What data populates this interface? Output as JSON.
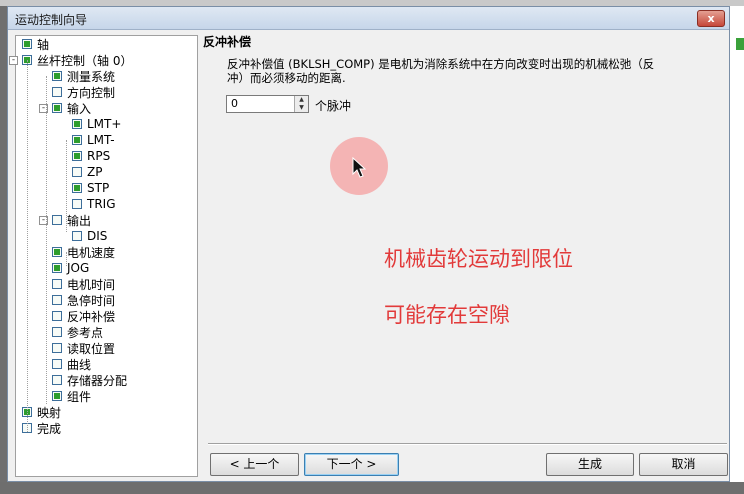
{
  "window": {
    "title": "运动控制向导",
    "close_label": "x"
  },
  "tree": [
    {
      "label": "轴",
      "state": "on",
      "depth": 0,
      "expander": ""
    },
    {
      "label": "丝杆控制（轴 0）",
      "state": "on",
      "depth": 0,
      "expander": "-"
    },
    {
      "label": "测量系统",
      "state": "on",
      "depth": 1,
      "expander": ""
    },
    {
      "label": "方向控制",
      "state": "off",
      "depth": 1,
      "expander": ""
    },
    {
      "label": "输入",
      "state": "on",
      "depth": 1,
      "expander": "-"
    },
    {
      "label": "LMT+",
      "state": "on",
      "depth": 2,
      "expander": ""
    },
    {
      "label": "LMT-",
      "state": "on",
      "depth": 2,
      "expander": ""
    },
    {
      "label": "RPS",
      "state": "on",
      "depth": 2,
      "expander": ""
    },
    {
      "label": "ZP",
      "state": "off",
      "depth": 2,
      "expander": ""
    },
    {
      "label": "STP",
      "state": "on",
      "depth": 2,
      "expander": ""
    },
    {
      "label": "TRIG",
      "state": "off",
      "depth": 2,
      "expander": ""
    },
    {
      "label": "输出",
      "state": "off",
      "depth": 1,
      "expander": "-"
    },
    {
      "label": "DIS",
      "state": "off",
      "depth": 2,
      "expander": ""
    },
    {
      "label": "电机速度",
      "state": "on",
      "depth": 1,
      "expander": ""
    },
    {
      "label": "JOG",
      "state": "on",
      "depth": 1,
      "expander": ""
    },
    {
      "label": "电机时间",
      "state": "off",
      "depth": 1,
      "expander": ""
    },
    {
      "label": "急停时间",
      "state": "off",
      "depth": 1,
      "expander": ""
    },
    {
      "label": "反冲补偿",
      "state": "off",
      "depth": 1,
      "expander": ""
    },
    {
      "label": "参考点",
      "state": "off",
      "depth": 1,
      "expander": ""
    },
    {
      "label": "读取位置",
      "state": "off",
      "depth": 1,
      "expander": ""
    },
    {
      "label": "曲线",
      "state": "off",
      "depth": 1,
      "expander": ""
    },
    {
      "label": "存储器分配",
      "state": "off",
      "depth": 1,
      "expander": ""
    },
    {
      "label": "组件",
      "state": "on",
      "depth": 1,
      "expander": ""
    },
    {
      "label": "映射",
      "state": "on",
      "depth": 0,
      "expander": ""
    },
    {
      "label": "完成",
      "state": "off",
      "depth": 0,
      "expander": ""
    }
  ],
  "panel": {
    "heading": "反冲补偿",
    "description": "反冲补偿值 (BKLSH_COMP) 是电机为消除系统中在方向改变时出现的机械松弛（反冲）而必须移动的距离.",
    "spin_value": "0",
    "unit": "个脉冲"
  },
  "annotations": {
    "line1": "机械齿轮运动到限位",
    "line2": "可能存在空隙"
  },
  "buttons": {
    "prev": "< 上一个",
    "next": "下一个 >",
    "finish": "生成",
    "cancel": "取消"
  },
  "colors": {
    "check_green": "#2d9d2d",
    "annotation_red": "#e23a3a",
    "cursor_highlight": "#f5a0a0"
  }
}
